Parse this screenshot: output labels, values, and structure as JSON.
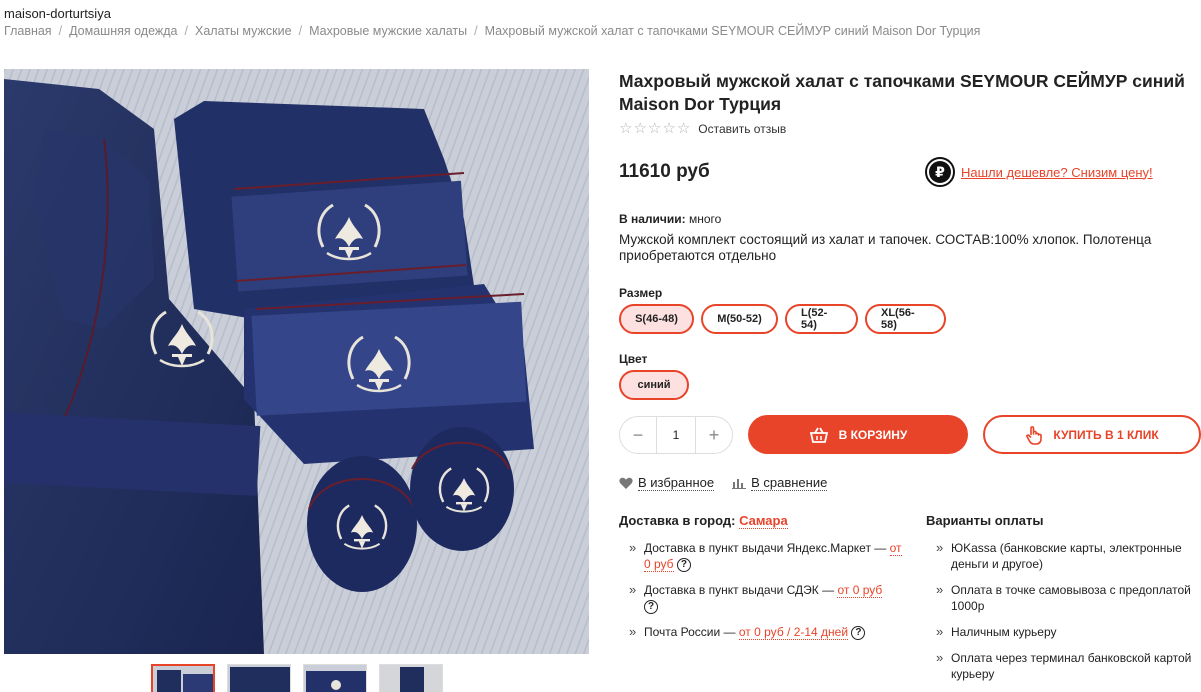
{
  "header": {
    "shop_name": "maison-dorturtsiya"
  },
  "breadcrumb": [
    "Главная",
    "Домашняя одежда",
    "Халаты мужские",
    "Махровые мужские халаты",
    "Махровый мужской халат с тапочками SEYMOUR СЕЙМУР синий Maison Dor Турция"
  ],
  "product": {
    "title": "Махровый мужской халат с тапочками SEYMOUR СЕЙМУР синий Maison Dor Турция",
    "rating_stars": 0,
    "rating_max": 5,
    "review_link": "Оставить отзыв",
    "price": "11610 руб",
    "cheaper_link": "Нашли дешевле? Снизим цену!",
    "stock_label": "В наличии:",
    "stock_value": "много",
    "description": "Мужской комплект состоящий из халат и тапочек. СОСТАВ:100% хлопок. Полотенца приобретаются отдельно"
  },
  "options": {
    "size_label": "Размер",
    "sizes": [
      "S(46-48)",
      "M(50-52)",
      "L(52-54)",
      "XL(56-58)"
    ],
    "selected_size": "S(46-48)",
    "color_label": "Цвет",
    "colors": [
      "синий"
    ],
    "selected_color": "синий"
  },
  "purchase": {
    "minus": "−",
    "quantity": "1",
    "plus": "+",
    "cart_button": "В КОРЗИНУ",
    "one_click_button": "КУПИТЬ В 1 КЛИК"
  },
  "actions": {
    "favorites": "В избранное",
    "compare": "В сравнение"
  },
  "delivery": {
    "heading": "Доставка в город:",
    "city": "Самара",
    "items": [
      {
        "text": "Доставка в пункт выдачи Яндекс.Маркет —",
        "price": "от 0 руб",
        "help": true
      },
      {
        "text": "Доставка в пункт выдачи СДЭК —",
        "price": "от 0 руб",
        "help": true
      },
      {
        "text": "Почта России —",
        "price": "от 0 руб / 2-14 дней",
        "help": true
      }
    ]
  },
  "payment": {
    "heading": "Варианты оплаты",
    "items": [
      "ЮKassa (банковские карты, электронные деньги и другое)",
      "Оплата в точке самовывоза с предоплатой 1000р",
      "Наличным курьеру",
      "Оплата через терминал банковской картой курьеру"
    ]
  },
  "colors": {
    "accent": "#e8442a",
    "navy": "#1f2e5c",
    "selected_bg": "#fde1e1"
  },
  "icons": {
    "star": "star-outline-icon",
    "ruble": "ruble-badge-icon",
    "basket": "basket-icon",
    "hand": "hand-pointer-icon",
    "heart": "heart-icon",
    "chart": "bar-chart-icon",
    "help": "question-circle-icon"
  }
}
